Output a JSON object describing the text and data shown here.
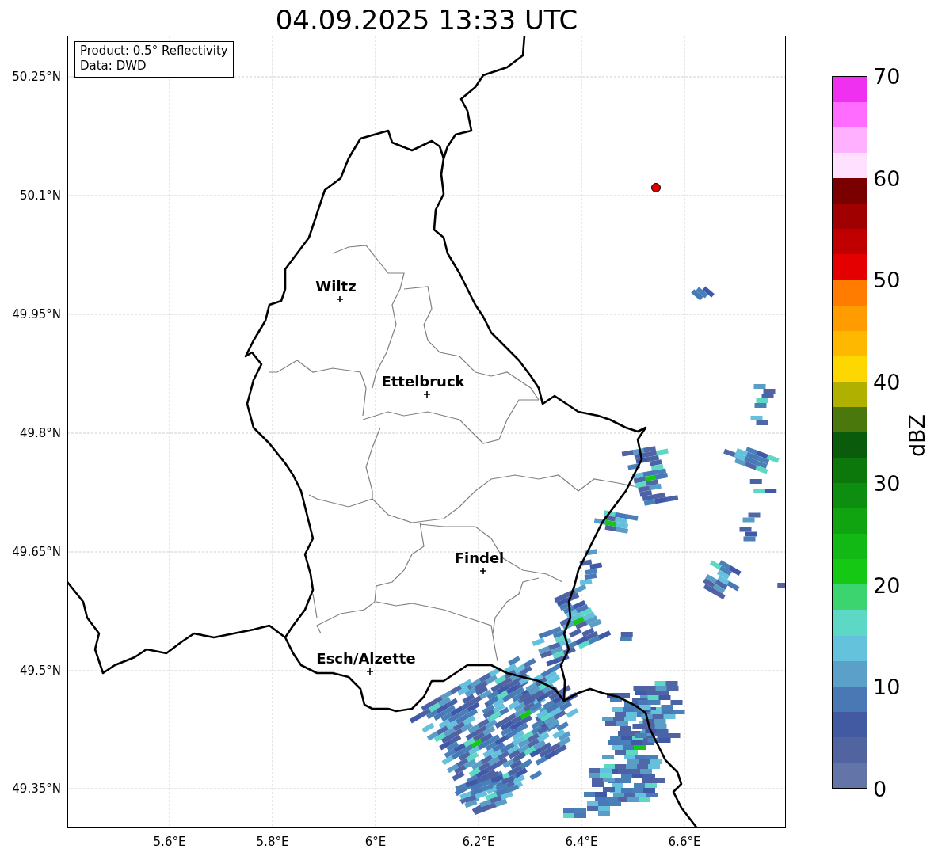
{
  "title": "04.09.2025 13:33 UTC",
  "info_box": [
    "Product: 0.5° Reflectivity",
    "Data: DWD"
  ],
  "map": {
    "lat_ticks": [
      "50.25°N",
      "50.1°N",
      "49.95°N",
      "49.8°N",
      "49.65°N",
      "49.5°N",
      "49.35°N"
    ],
    "lon_ticks": [
      "5.6°E",
      "5.8°E",
      "6°E",
      "6.2°E",
      "6.4°E",
      "6.6°E"
    ],
    "cities": [
      {
        "name": "Wiltz"
      },
      {
        "name": "Ettelbruck"
      },
      {
        "name": "Findel"
      },
      {
        "name": "Esch/Alzette"
      }
    ],
    "marker": {
      "color": "#e00000"
    }
  },
  "colorbar": {
    "label": "dBZ",
    "ticks": [
      "70",
      "60",
      "50",
      "40",
      "30",
      "20",
      "10",
      "0"
    ],
    "segments": [
      {
        "color": "#6274a8"
      },
      {
        "color": "#5264a0"
      },
      {
        "color": "#425aa2"
      },
      {
        "color": "#4a78b4"
      },
      {
        "color": "#5aa0c8"
      },
      {
        "color": "#64c2dc"
      },
      {
        "color": "#5cd8c4"
      },
      {
        "color": "#3cd46e"
      },
      {
        "color": "#14c814"
      },
      {
        "color": "#12b814"
      },
      {
        "color": "#10a410"
      },
      {
        "color": "#0e8e10"
      },
      {
        "color": "#0c780c"
      },
      {
        "color": "#0a5c0c"
      },
      {
        "color": "#4a780c"
      },
      {
        "color": "#b0b000"
      },
      {
        "color": "#ffd700"
      },
      {
        "color": "#ffb800"
      },
      {
        "color": "#ff9c00"
      },
      {
        "color": "#ff7c00"
      },
      {
        "color": "#e40000"
      },
      {
        "color": "#c00000"
      },
      {
        "color": "#a00000"
      },
      {
        "color": "#7a0000"
      },
      {
        "color": "#ffe0ff"
      },
      {
        "color": "#ffb0ff"
      },
      {
        "color": "#ff6cff"
      },
      {
        "color": "#f030f0"
      }
    ]
  }
}
